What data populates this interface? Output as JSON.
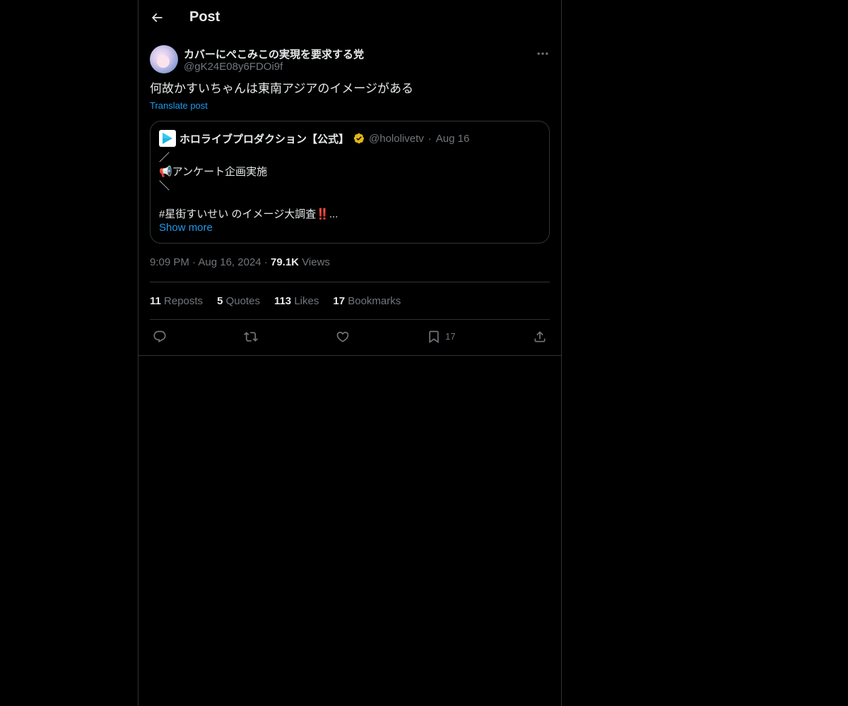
{
  "header": {
    "title": "Post"
  },
  "post": {
    "author_name": "カバーにぺこみこの実現を要求する党",
    "author_handle": "@gK24E08y6FDOi9f",
    "text": "何故かすいちゃんは東南アジアのイメージがある",
    "translate_label": "Translate post",
    "quote": {
      "name": "ホロライブプロダクション【公式】",
      "handle": "@hololivetv",
      "date": "Aug 16",
      "lines": [
        "／",
        "📢アンケート企画実施",
        "＼",
        "",
        "#星街すいせい のイメージ大調査‼️..."
      ],
      "show_more": "Show more"
    },
    "time": "9:09 PM",
    "date": "Aug 16, 2024",
    "views_count": "79.1K",
    "views_label": "Views"
  },
  "stats": {
    "reposts_count": "11",
    "reposts_label": "Reposts",
    "quotes_count": "5",
    "quotes_label": "Quotes",
    "likes_count": "113",
    "likes_label": "Likes",
    "bookmarks_count": "17",
    "bookmarks_label": "Bookmarks"
  },
  "actions": {
    "bookmark_count": "17",
    "icons": [
      "reply-icon",
      "repost-icon",
      "like-icon",
      "bookmark-icon",
      "share-icon"
    ]
  },
  "colors": {
    "background": "#000000",
    "text": "#e7e9ea",
    "muted": "#71767b",
    "link": "#1d9bf0",
    "border": "#2f3336",
    "verified_gold": "#e2b719"
  }
}
